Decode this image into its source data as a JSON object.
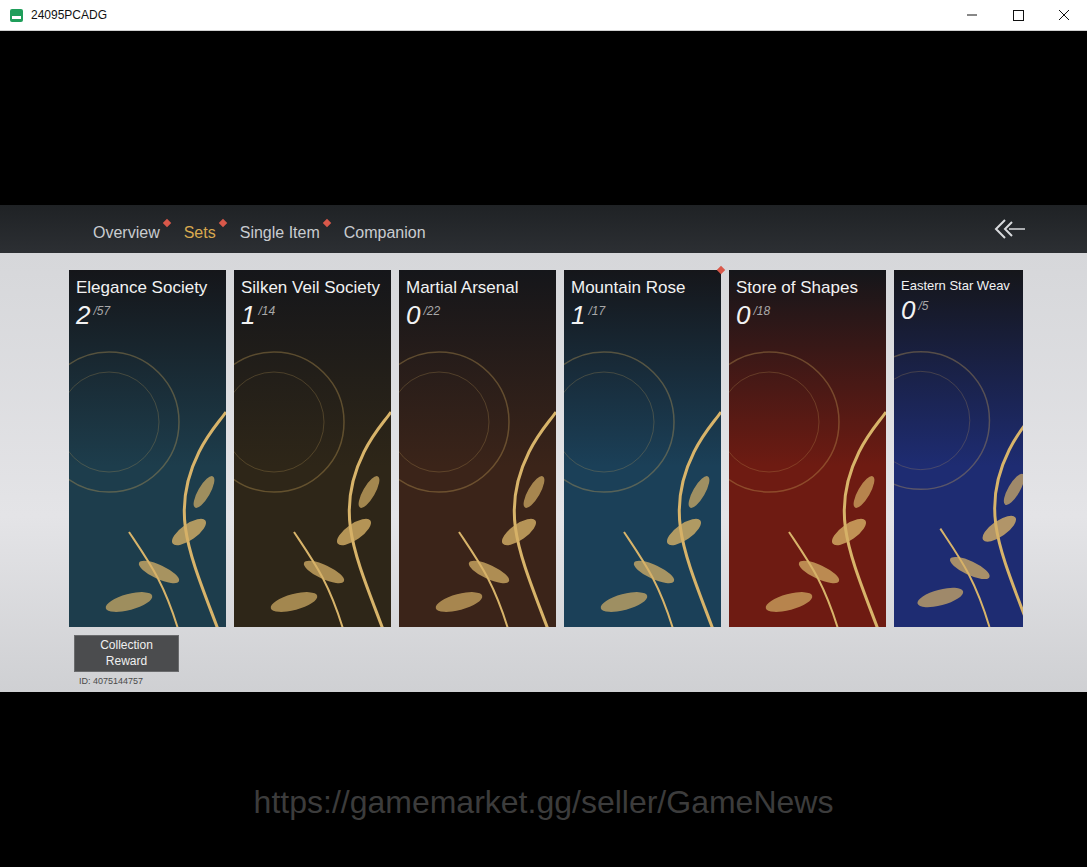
{
  "window": {
    "title": "24095PCADG"
  },
  "tabs": [
    {
      "label": "Overview",
      "selected": false,
      "badge": true
    },
    {
      "label": "Sets",
      "selected": true,
      "badge": true
    },
    {
      "label": "Single Item",
      "selected": false,
      "badge": true
    },
    {
      "label": "Companion",
      "selected": false,
      "badge": false
    }
  ],
  "cards": [
    {
      "title": "Elegance Society",
      "count": "2",
      "total": "/57",
      "badge": false,
      "color": "#1d3d4c"
    },
    {
      "title": "Silken Veil Society",
      "count": "1",
      "total": "/14",
      "badge": false,
      "color": "#2e2618"
    },
    {
      "title": "Martial Arsenal",
      "count": "0",
      "total": "/22",
      "badge": false,
      "color": "#3b2419"
    },
    {
      "title": "Mountain Rose",
      "count": "1",
      "total": "/17",
      "badge": true,
      "color": "#1b4058"
    },
    {
      "title": "Store of Shapes",
      "count": "0",
      "total": "/18",
      "badge": false,
      "color": "#6e1b12"
    },
    {
      "title": "Eastern Star Weav",
      "count": "0",
      "total": "/5",
      "badge": false,
      "color": "#1e2c72"
    }
  ],
  "collection_reward": "Collection Reward",
  "id_label": "ID: 4075144757",
  "watermark": "https://gamemarket.gg/seller/GameNews"
}
